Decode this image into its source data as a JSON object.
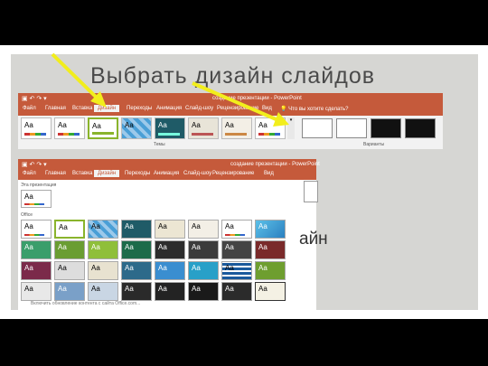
{
  "slide": {
    "title": "Выбрать дизайн слайдов"
  },
  "ribbon_top": {
    "window_title": "создание презентации - PowerPoint",
    "tabs": [
      "Файл",
      "Главная",
      "Вставка",
      "Дизайн",
      "Переходы",
      "Анимация",
      "Слайд-шоу",
      "Рецензирование",
      "Вид"
    ],
    "active_tab": "Дизайн",
    "tell_me": "Что вы хотите сделать?",
    "themes_group_label": "Темы",
    "variants_group_label": "Варианты",
    "theme_glyph": "Aa"
  },
  "ribbon_gallery": {
    "window_title": "создание презентации - PowerPoint",
    "tabs": [
      "Файл",
      "Главная",
      "Вставка",
      "Дизайн",
      "Переходы",
      "Анимация",
      "Слайд-шоу",
      "Рецензирование",
      "Вид"
    ],
    "active_tab": "Дизайн",
    "this_presentation_label": "Эта презентация",
    "office_label": "Office",
    "footer_text": "Включить обновление контента с сайта Office.com...",
    "theme_glyph": "Aa"
  },
  "background_text": "айн",
  "colors": {
    "accent": "#c55a3b",
    "arrow": "#f2ee1c"
  }
}
